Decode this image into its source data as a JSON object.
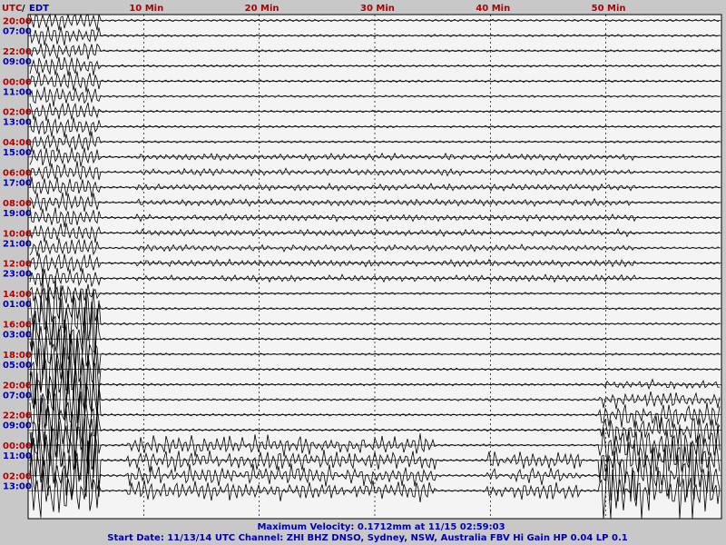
{
  "header": {
    "utc_label": "UTC",
    "separator": "/",
    "local_label": "EDT"
  },
  "footer": {
    "line1": "Maximum Velocity: 0.1712mm at 11/15 02:59:03",
    "line2": "Start Date: 11/13/14 UTC Channel: ZHI  BHZ  DNSO, Sydney, NSW, Australia  FBV Hi Gain HP 0.04 LP 0.1"
  },
  "colors": {
    "utc": "#b00000",
    "local": "#0000b0",
    "trace": "#000000",
    "background": "#f4f4f4",
    "frame": "#c8c8c8",
    "grid": "#000000"
  },
  "chart_data": {
    "type": "line",
    "title": "",
    "xlabel": "",
    "ylabel": "",
    "xlim": [
      0,
      60
    ],
    "x_ticks": [
      {
        "value": 10,
        "label": "10 Min"
      },
      {
        "value": 20,
        "label": "20 Min"
      },
      {
        "value": 30,
        "label": "30 Min"
      },
      {
        "value": 40,
        "label": "40 Min"
      },
      {
        "value": 50,
        "label": "50 Min"
      }
    ],
    "row_labels": [
      {
        "utc": "20:00",
        "local": "07:00"
      },
      {
        "utc": "22:00",
        "local": "09:00"
      },
      {
        "utc": "00:00",
        "local": "11:00"
      },
      {
        "utc": "02:00",
        "local": "13:00"
      },
      {
        "utc": "04:00",
        "local": "15:00"
      },
      {
        "utc": "06:00",
        "local": "17:00"
      },
      {
        "utc": "08:00",
        "local": "19:00"
      },
      {
        "utc": "10:00",
        "local": "21:00"
      },
      {
        "utc": "12:00",
        "local": "23:00"
      },
      {
        "utc": "14:00",
        "local": "01:00"
      },
      {
        "utc": "16:00",
        "local": "03:00"
      },
      {
        "utc": "18:00",
        "local": "05:00"
      },
      {
        "utc": "20:00",
        "local": "07:00"
      },
      {
        "utc": "22:00",
        "local": "09:00"
      },
      {
        "utc": "00:00",
        "local": "11:00"
      },
      {
        "utc": "02:00",
        "local": "13:00"
      }
    ],
    "grid": true
  }
}
